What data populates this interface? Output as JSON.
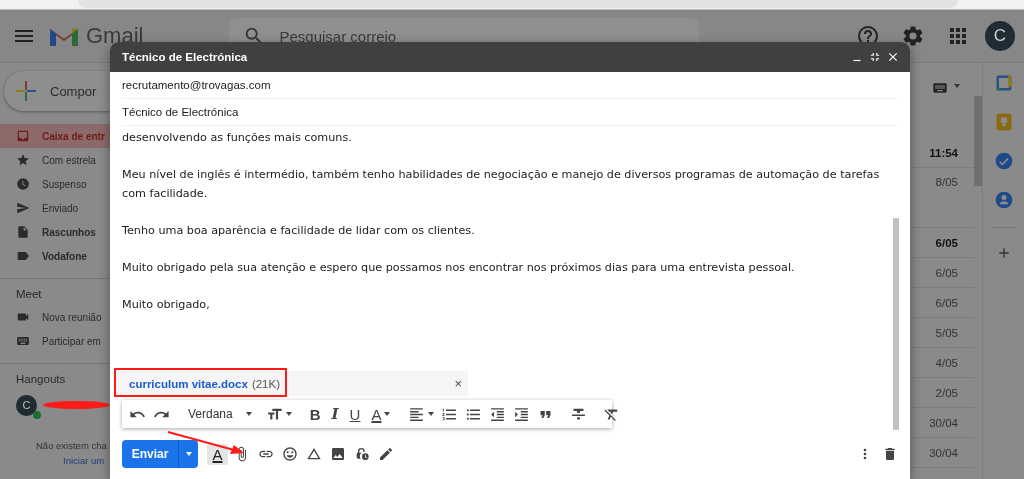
{
  "header": {
    "product": "Gmail",
    "search": {
      "placeholder": "Pesquisar correio"
    },
    "avatar": "C"
  },
  "compose_button": "Compor",
  "sidebar": {
    "items": [
      {
        "label": "Caixa de entr",
        "kind": "inbox",
        "selected": true,
        "bold": true
      },
      {
        "label": "Com estrela",
        "kind": "star",
        "selected": false,
        "bold": false
      },
      {
        "label": "Suspenso",
        "kind": "clock",
        "selected": false,
        "bold": false
      },
      {
        "label": "Enviado",
        "kind": "send",
        "selected": false,
        "bold": false
      },
      {
        "label": "Rascunhos",
        "kind": "file",
        "selected": false,
        "bold": true
      },
      {
        "label": "Vodafone",
        "kind": "label",
        "selected": false,
        "bold": true
      }
    ]
  },
  "meet": {
    "title": "Meet",
    "items": [
      {
        "label": "Nova reunião",
        "kind": "video"
      },
      {
        "label": "Participar em",
        "kind": "keyboard"
      }
    ]
  },
  "hangouts": {
    "title": "Hangouts",
    "avatar": "C",
    "online": true,
    "empty_message": "Não existem cha",
    "start_link": "Iniciar um"
  },
  "mail_list": {
    "dates": [
      {
        "text": "11:54",
        "bold": true,
        "tall": false
      },
      {
        "text": "8/05",
        "bold": false,
        "tall": true
      },
      {
        "text": "6/05",
        "bold": true,
        "tall": false
      },
      {
        "text": "6/05",
        "bold": false,
        "tall": false
      },
      {
        "text": "6/05",
        "bold": false,
        "tall": false
      },
      {
        "text": "5/05",
        "bold": false,
        "tall": false
      },
      {
        "text": "4/05",
        "bold": false,
        "tall": false
      },
      {
        "text": "2/05",
        "bold": false,
        "tall": false
      },
      {
        "text": "30/04",
        "bold": false,
        "tall": false
      },
      {
        "text": "30/04",
        "bold": false,
        "tall": false
      }
    ]
  },
  "compose": {
    "title": "Técnico de Electrónica",
    "to": "recrutamento@trovagas.com",
    "subject": "Técnico de Electrónica",
    "body": [
      "desenvolvendo as funções mais comuns.",
      "Meu nível de inglês é intermédio, também tenho habilidades de negociação e manejo de diversos programas de automação de tarefas com facilidade.",
      "Tenho uma boa aparência e facilidade de lidar com os clientes.",
      "Muito obrigado pela sua atenção e espero que possamos nos encontrar nos próximos dias para uma entrevista pessoal.",
      "Muito obrigado,"
    ],
    "attachment": {
      "name": "curriculum vitae.docx",
      "size": "(21K)",
      "remove": "×"
    },
    "format_toolbar": [
      {
        "kind": "undo"
      },
      {
        "kind": "redo"
      },
      {
        "kind": "sep"
      },
      {
        "kind": "font",
        "label": "Verdana"
      },
      {
        "kind": "sep"
      },
      {
        "kind": "size"
      },
      {
        "kind": "sep"
      },
      {
        "kind": "bold",
        "glyph": "B"
      },
      {
        "kind": "italic",
        "glyph": "I"
      },
      {
        "kind": "underline",
        "glyph": "U"
      },
      {
        "kind": "color",
        "glyph": "A"
      },
      {
        "kind": "sep"
      },
      {
        "kind": "align"
      },
      {
        "kind": "numbered"
      },
      {
        "kind": "bulleted"
      },
      {
        "kind": "outdent"
      },
      {
        "kind": "indent"
      },
      {
        "kind": "quote"
      },
      {
        "kind": "sep"
      },
      {
        "kind": "strike"
      },
      {
        "kind": "sep"
      },
      {
        "kind": "clear"
      }
    ],
    "send": "Enviar",
    "actions": [
      {
        "kind": "formatting",
        "glyph": "A",
        "active": true
      },
      {
        "kind": "attach",
        "active": false
      },
      {
        "kind": "link",
        "active": false
      },
      {
        "kind": "emoji",
        "active": false
      },
      {
        "kind": "drive",
        "active": false
      },
      {
        "kind": "photo",
        "active": false
      },
      {
        "kind": "confidential",
        "active": false
      },
      {
        "kind": "signature",
        "active": false
      }
    ]
  }
}
